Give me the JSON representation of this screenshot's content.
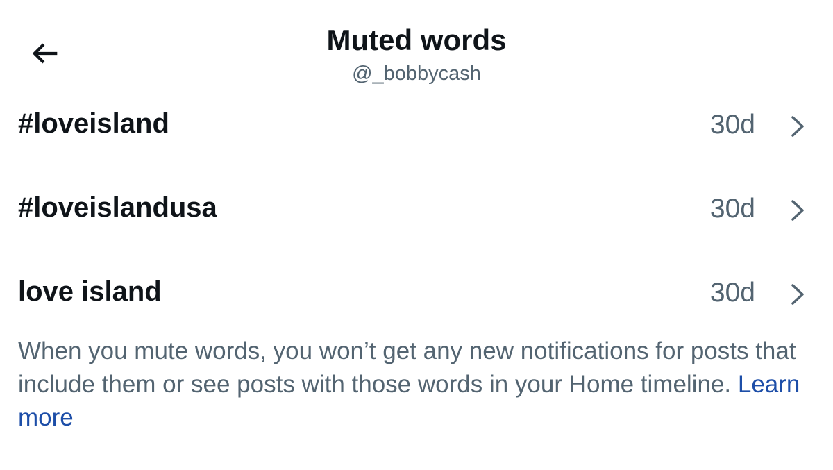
{
  "header": {
    "back_icon": "arrow-left-icon",
    "title": "Muted words",
    "subtitle": "@_bobbycash"
  },
  "muted_words": [
    {
      "word": "#loveisland",
      "duration": "30d",
      "icon": "chevron-right-icon"
    },
    {
      "word": "#loveislandusa",
      "duration": "30d",
      "icon": "chevron-right-icon"
    },
    {
      "word": "love island",
      "duration": "30d",
      "icon": "chevron-right-icon"
    }
  ],
  "footer": {
    "description": "When you mute words, you won’t get any new notifications for posts that include them or see posts with those words in your Home timeline.",
    "link_label": "Learn more"
  },
  "colors": {
    "primary_text": "#0f1419",
    "secondary_text": "#536471",
    "link": "#1d4ea8",
    "background": "#ffffff"
  }
}
